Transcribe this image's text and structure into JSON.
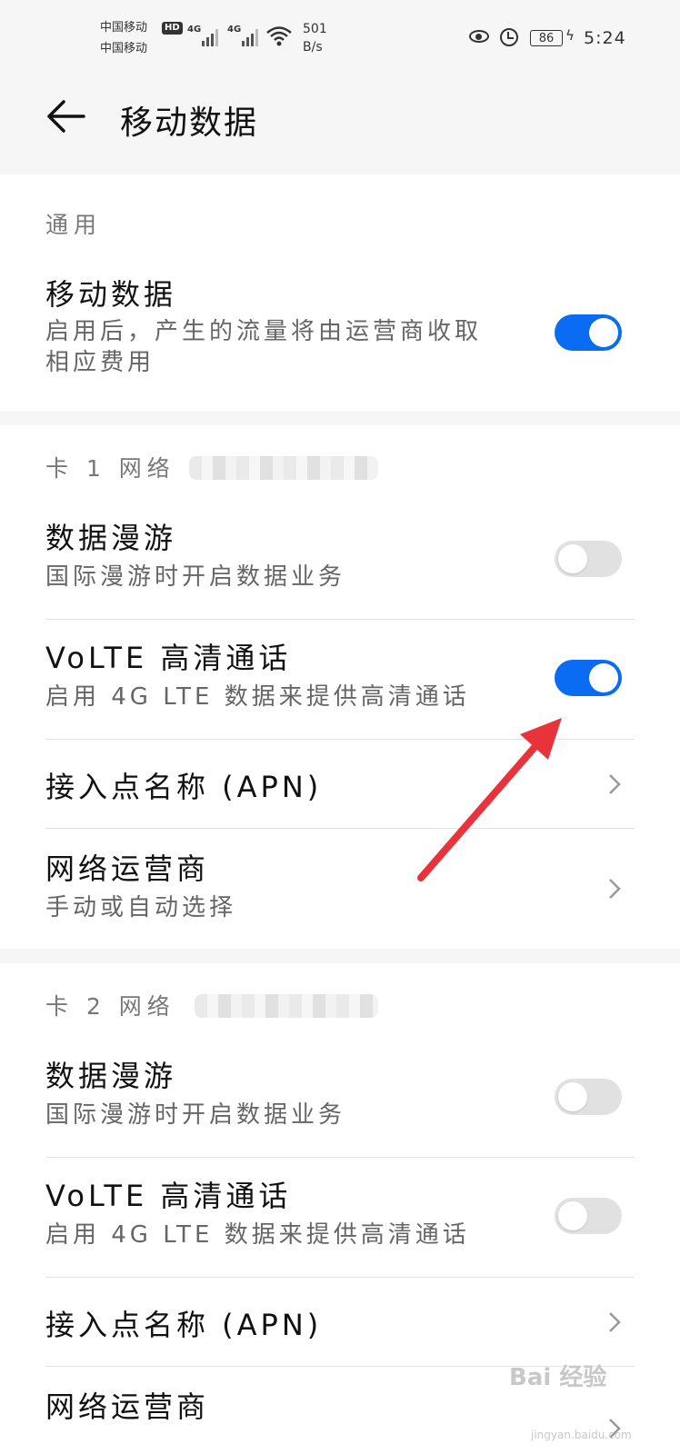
{
  "status_bar": {
    "carrier1": "中国移动",
    "carrier2": "中国移动",
    "hd": "HD",
    "net1": "4G",
    "net2": "4G",
    "speed_value": "501",
    "speed_unit": "B/s",
    "battery": "86",
    "time": "5:24"
  },
  "header": {
    "title": "移动数据"
  },
  "general": {
    "section_label": "通用",
    "mobile_data": {
      "title": "移动数据",
      "subtitle_line1": "启用后，产生的流量将由运营商收取",
      "subtitle_line2": "相应费用",
      "enabled": true
    }
  },
  "card1": {
    "section_label": "卡 1 网络",
    "data_roaming": {
      "title": "数据漫游",
      "subtitle": "国际漫游时开启数据业务",
      "enabled": false
    },
    "volte": {
      "title": "VoLTE 高清通话",
      "subtitle": "启用 4G LTE 数据来提供高清通话",
      "enabled": true
    },
    "apn": {
      "title": "接入点名称 (APN)"
    },
    "operator": {
      "title": "网络运营商",
      "subtitle": "手动或自动选择"
    }
  },
  "card2": {
    "section_label": "卡 2 网络",
    "data_roaming": {
      "title": "数据漫游",
      "subtitle": "国际漫游时开启数据业务",
      "enabled": false
    },
    "volte": {
      "title": "VoLTE 高清通话",
      "subtitle": "启用 4G LTE 数据来提供高清通话",
      "enabled": false
    },
    "apn": {
      "title": "接入点名称 (APN)"
    },
    "operator": {
      "title": "网络运营商"
    }
  },
  "watermark": {
    "brand": "Bai 经验",
    "url": "jingyan.baidu.com"
  },
  "colors": {
    "toggle_on": "#0a6cf2",
    "toggle_off": "#e1e1e1",
    "annotation_arrow": "#e8333b"
  }
}
